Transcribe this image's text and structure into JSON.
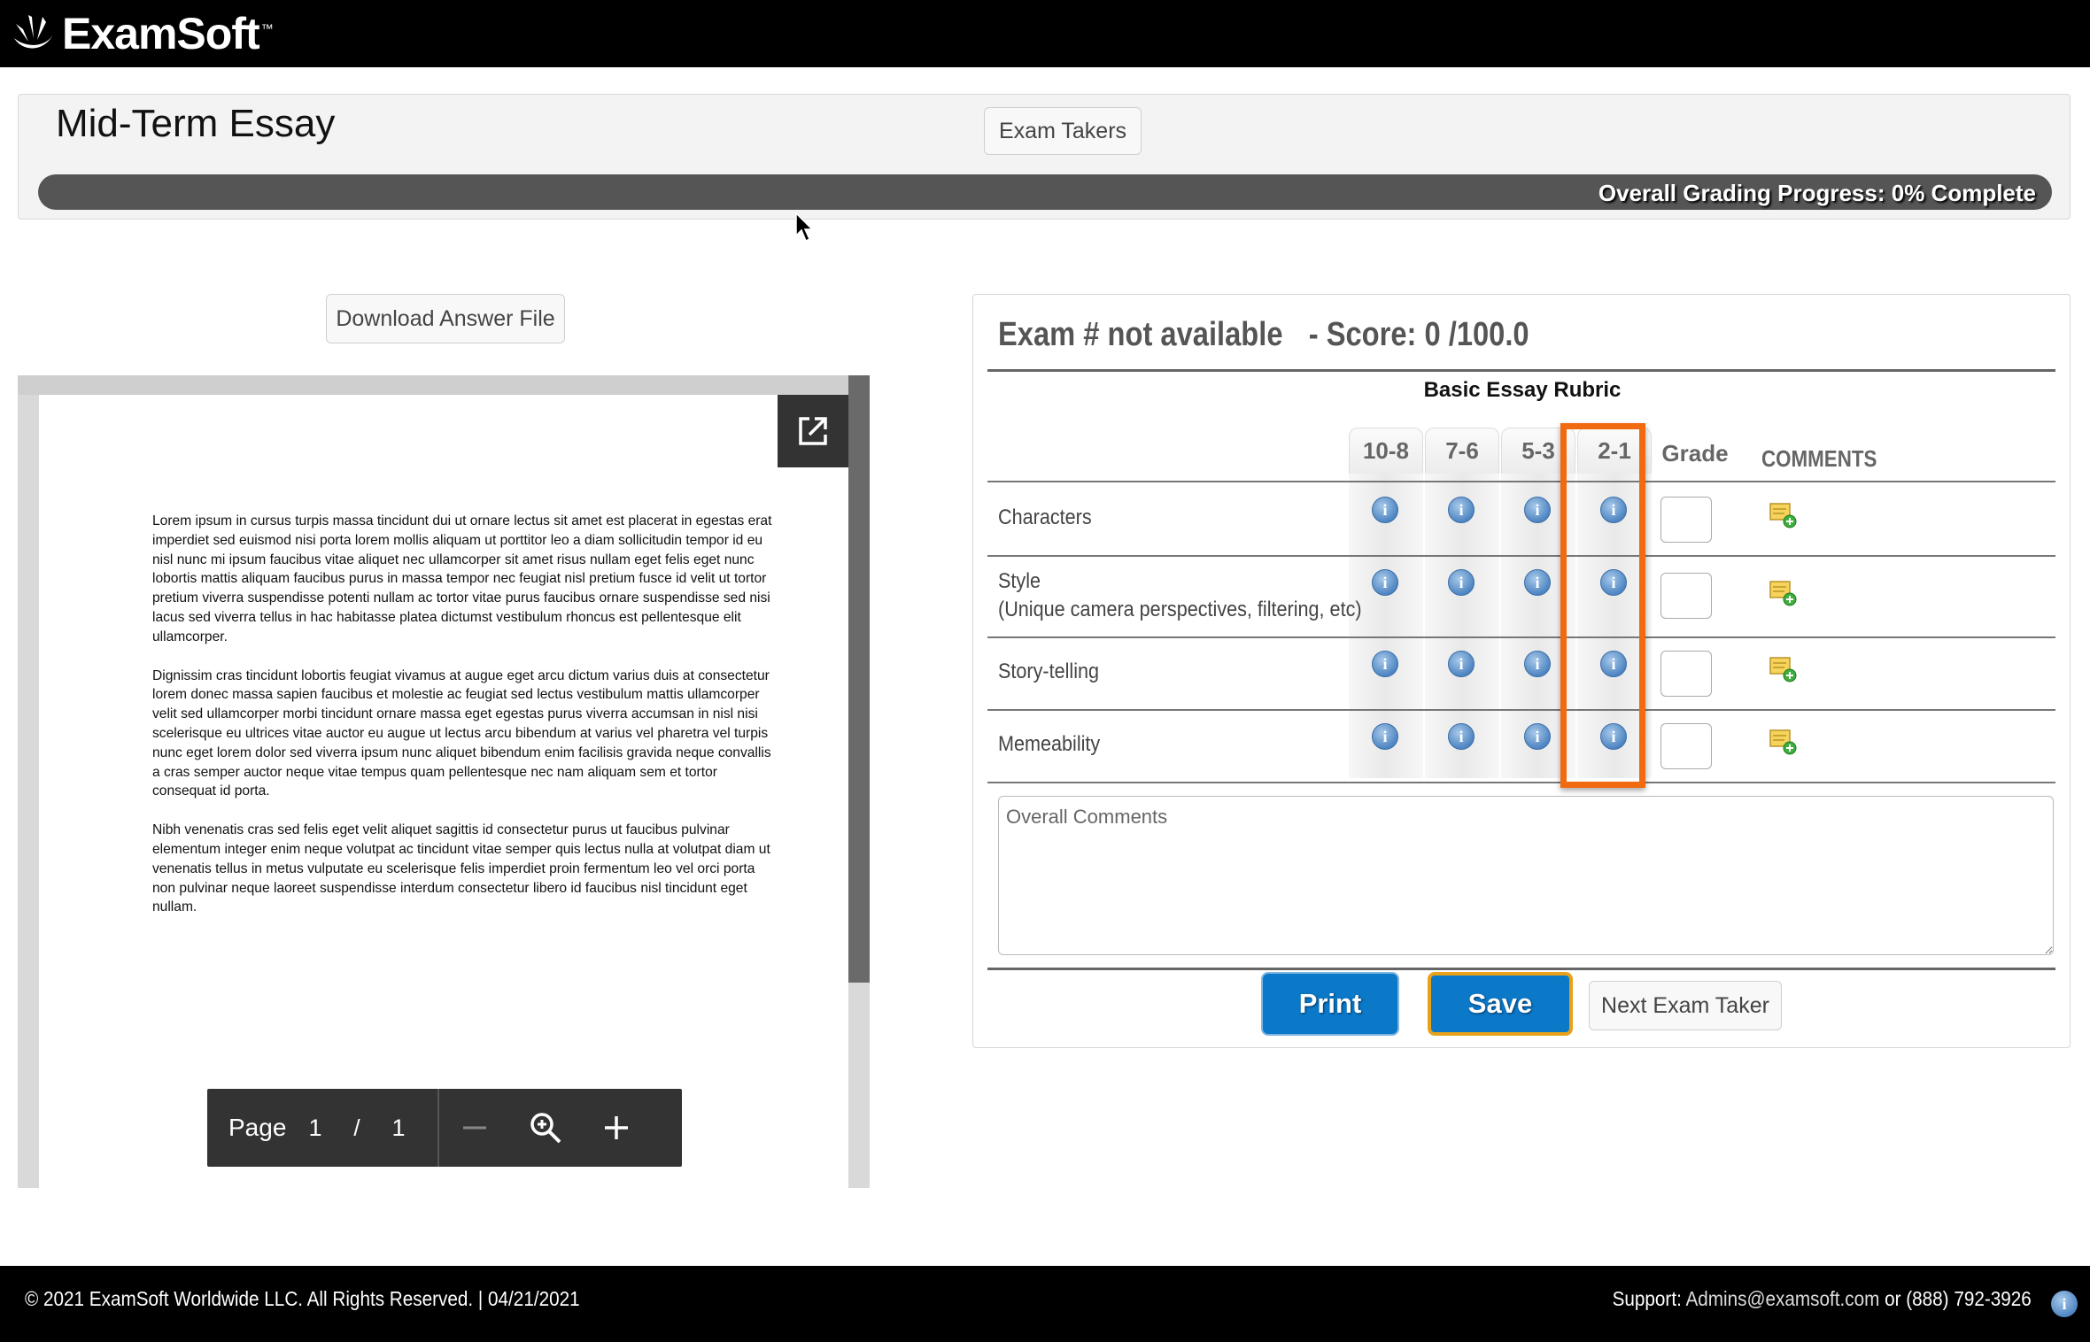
{
  "app": {
    "logo_text": "ExamSoft",
    "logo_tm": "™"
  },
  "header": {
    "exam_title": "Mid-Term Essay",
    "exam_takers_label": "Exam Takers",
    "progress_label": "Overall Grading Progress: 0% Complete",
    "progress_percent": 0
  },
  "viewer": {
    "download_label": "Download Answer File",
    "paragraphs": [
      "Lorem ipsum in cursus turpis massa tincidunt dui ut ornare lectus sit amet est placerat in egestas erat imperdiet sed euismod nisi porta lorem mollis aliquam ut porttitor leo a diam sollicitudin tempor id eu nisl nunc mi ipsum faucibus vitae aliquet nec ullamcorper sit amet risus nullam eget felis eget nunc lobortis mattis aliquam faucibus purus in massa tempor nec feugiat nisl pretium fusce id velit ut tortor pretium viverra suspendisse potenti nullam ac tortor vitae purus faucibus ornare suspendisse sed nisi lacus sed viverra tellus in hac habitasse platea dictumst vestibulum rhoncus est pellentesque elit ullamcorper.",
      "Dignissim cras tincidunt lobortis feugiat vivamus at augue eget arcu dictum varius duis at consectetur lorem donec massa sapien faucibus et molestie ac feugiat sed lectus vestibulum mattis ullamcorper velit sed ullamcorper morbi tincidunt ornare massa eget egestas purus viverra accumsan in nisl nisi scelerisque eu ultrices vitae auctor eu augue ut lectus arcu bibendum at varius vel pharetra vel turpis nunc eget lorem dolor sed viverra ipsum nunc aliquet bibendum enim facilisis gravida neque convallis a cras semper auctor neque vitae tempus quam pellentesque nec nam aliquam sem et tortor consequat id porta.",
      "Nibh venenatis cras sed felis eget velit aliquet sagittis id consectetur purus ut faucibus pulvinar elementum integer enim neque volutpat ac tincidunt vitae semper quis lectus nulla at volutpat diam ut venenatis tellus in metus vulputate eu scelerisque felis imperdiet proin fermentum leo vel orci porta non pulvinar neque laoreet suspendisse interdum consectetur libero id faucibus nisl tincidunt eget nullam."
    ],
    "toolbar": {
      "page_label": "Page",
      "current_page": "1",
      "separator": "/",
      "total_pages": "1"
    }
  },
  "grading": {
    "exam_number": "Exam # not available",
    "score": "- Score: 0 /100.0",
    "rubric_title": "Basic Essay Rubric",
    "columns": [
      "10-8",
      "7-6",
      "5-3",
      "2-1"
    ],
    "grade_header": "Grade",
    "comments_header": "COMMENTS",
    "criteria": [
      {
        "label": "Characters",
        "sub": ""
      },
      {
        "label": "Style",
        "sub": "(Unique camera perspectives, filtering, etc)"
      },
      {
        "label": "Story-telling",
        "sub": ""
      },
      {
        "label": "Memeability",
        "sub": ""
      }
    ],
    "overall_comments_placeholder": "Overall Comments",
    "print_label": "Print",
    "save_label": "Save",
    "next_label": "Next Exam Taker",
    "highlight_color": "#f26a10",
    "button_blue": "#0b78c8"
  },
  "footer": {
    "copyright": "© 2021 ExamSoft Worldwide LLC. All Rights Reserved.   |   04/21/2021",
    "support_label": "Support: ",
    "support_email": "Admins@examsoft.com",
    "support_phone": " or (888) 792-3926"
  }
}
